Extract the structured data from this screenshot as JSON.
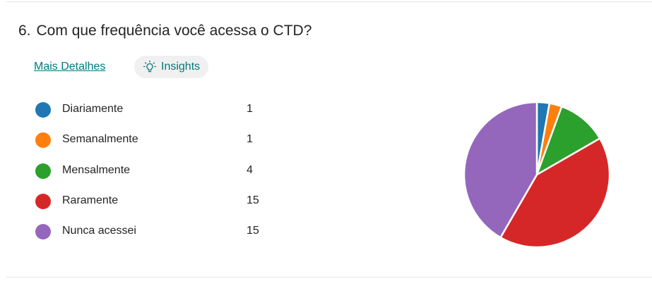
{
  "question": {
    "number": "6.",
    "text": "Com que frequência você acessa o CTD?"
  },
  "actions": {
    "details_label": "Mais Detalhes",
    "insights_label": "Insights",
    "insights_icon": "lightbulb-icon"
  },
  "chart_data": {
    "type": "pie",
    "categories": [
      "Diariamente",
      "Semanalmente",
      "Mensalmente",
      "Raramente",
      "Nunca acessei"
    ],
    "values": [
      1,
      1,
      4,
      15,
      15
    ],
    "colors": [
      "#1f77b4",
      "#ff7f0e",
      "#2ca02c",
      "#d62728",
      "#9467bd"
    ],
    "legend_position": "left"
  }
}
